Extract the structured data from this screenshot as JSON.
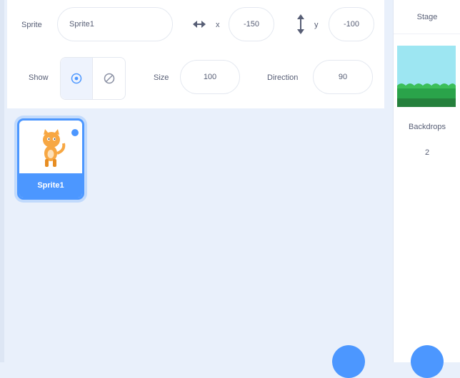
{
  "sprite_info": {
    "sprite_label": "Sprite",
    "sprite_name": "Sprite1",
    "x_label": "x",
    "x_value": "-150",
    "y_label": "y",
    "y_value": "-100",
    "show_label": "Show",
    "size_label": "Size",
    "size_value": "100",
    "direction_label": "Direction",
    "direction_value": "90"
  },
  "sprite_list": {
    "items": [
      {
        "name": "Sprite1",
        "selected": true
      }
    ]
  },
  "stage_panel": {
    "header": "Stage",
    "backdrops_label": "Backdrops",
    "backdrops_count": "2"
  },
  "colors": {
    "accent": "#4c97ff",
    "pane_bg": "#e9f0fb",
    "text": "#575e75",
    "sky": "#9de6f2",
    "grass": "#2aa34a"
  },
  "icons": {
    "x_axis": "horizontal-arrows-icon",
    "y_axis": "vertical-arrows-icon",
    "show_visible": "eye-icon",
    "show_hidden": "eye-slash-icon",
    "sprite_thumb": "cat-sprite-icon",
    "delete": "delete-badge-icon",
    "choose_sprite": "choose-sprite-button",
    "choose_backdrop": "choose-backdrop-button"
  }
}
